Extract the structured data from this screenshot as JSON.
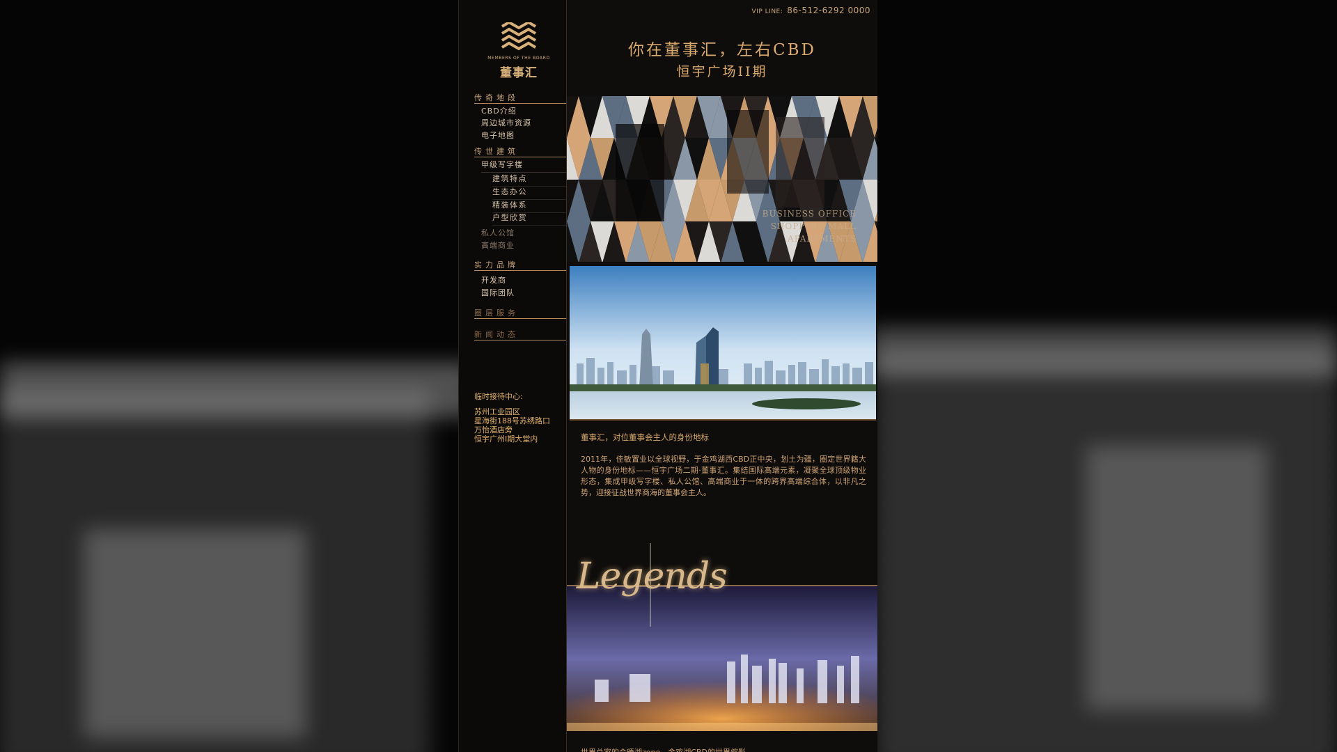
{
  "vip": {
    "label": "VIP LINE:",
    "number": "86-512-6292 0000"
  },
  "logo": {
    "en": "MEMBERS OF THE BOARD",
    "cn": "董事汇"
  },
  "nav": {
    "sections": [
      {
        "head": "传奇地段",
        "items": [
          "CBD介绍",
          "周边城市资源",
          "电子地图"
        ]
      },
      {
        "head": "传世建筑",
        "items": [
          "甲级写字楼"
        ],
        "subitems": [
          "建筑特点",
          "生态办公",
          "精装体系",
          "户型欣赏"
        ],
        "after": [
          "私人公馆",
          "高端商业"
        ]
      },
      {
        "head": "实力品牌",
        "items": [
          "开发商",
          "国际团队"
        ]
      },
      {
        "head": "圈层服务"
      },
      {
        "head": "新闻动态"
      }
    ]
  },
  "reception": {
    "title": "临时接待中心:",
    "lines": [
      "苏州工业园区",
      "星海街188号苏绣路口",
      "万怡酒店旁",
      "恒宇广州Ⅰ期大堂内"
    ]
  },
  "content": {
    "slogan1": "你在董事汇，左右CBD",
    "slogan2": "恒宇广场II期",
    "collage_text": [
      "BUSINESS OFFICE",
      "SHOPPING MALL",
      "APARTMENTS"
    ],
    "intro_head": "董事汇，对位董事会主人的身份地标",
    "intro_body": "2011年，佳敏置业以全球视野，于金鸡湖西CBD正中央，划土为疆，圈定世界籍大人物的身份地标——恒宇广场二期·董事汇。集结国际高端元素，凝聚全球顶级物业形态，集成甲级写字楼、私人公馆、高端商业于一体的跨界高端综合体，以非凡之势，迎接征战世界商海的董事会主人。",
    "legends": "Legends",
    "bottom_text": "世界总家的会晤湖zone，金鸡湖CBD的世界缩影"
  },
  "colors": {
    "gold": "#d9a96e",
    "dark": "#0d0c0b"
  }
}
